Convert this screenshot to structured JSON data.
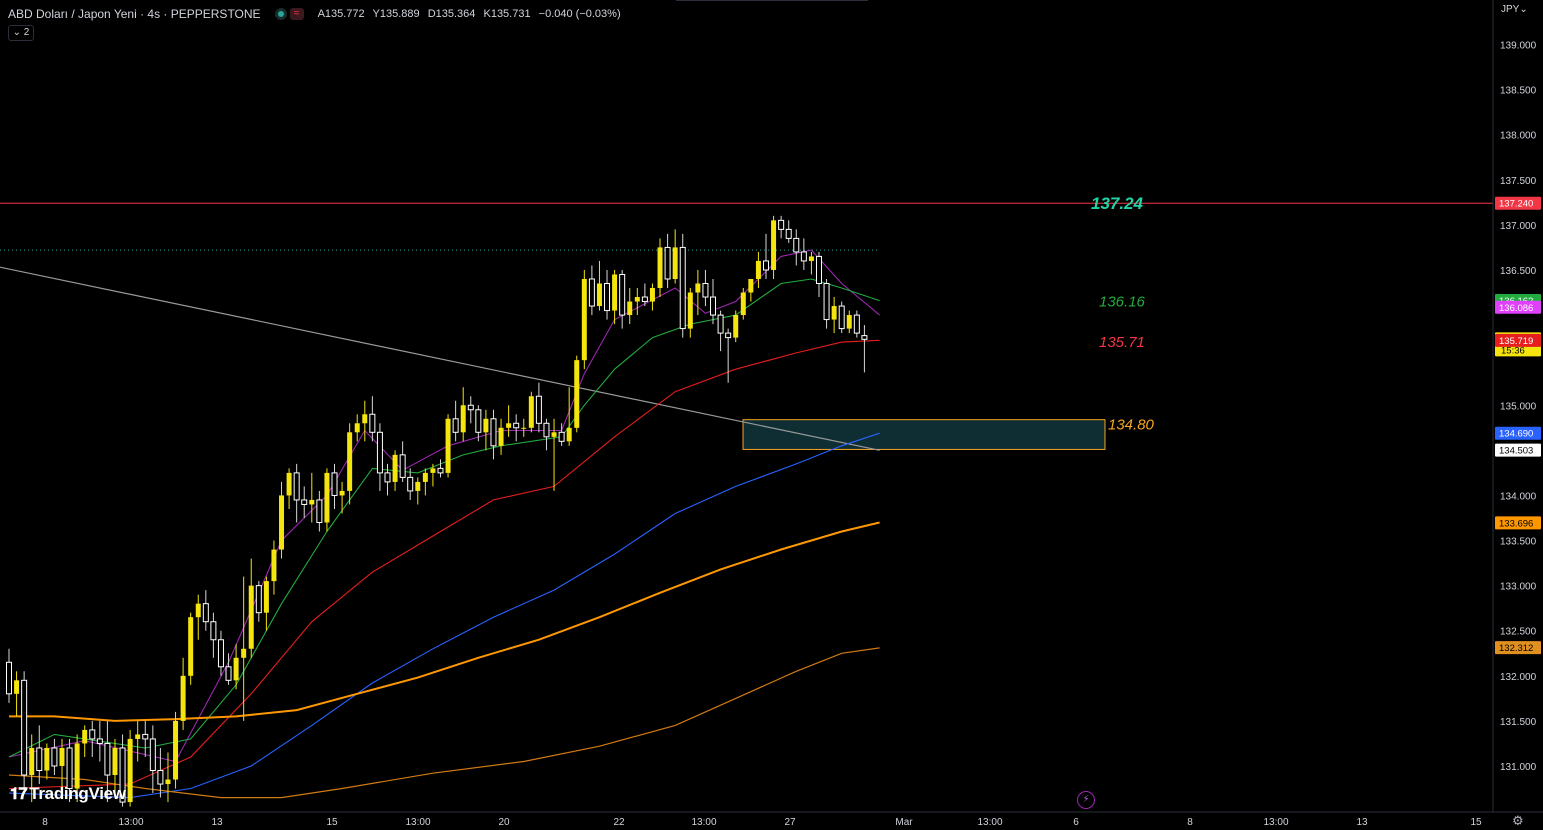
{
  "header": {
    "title": "ABD Doları / Japon Yeni · 4s · PEPPERSTONE",
    "wave_icon": "wave-icon",
    "open": "A135.772",
    "high": "Y135.889",
    "low": "D135.364",
    "close": "K135.731",
    "change": "−0.040 (−0.03%)",
    "collapse": "⌄ 2"
  },
  "currency": "JPY⌄",
  "brand": "TradingView",
  "colors": {
    "background": "#000000",
    "bull_candle": "#f5e50f",
    "bear_candle": "#ffffff",
    "resistance": "#f23645",
    "ema_8": "#9c27b0",
    "ema_21": "#22ab3e",
    "ema_50": "#e61e1e",
    "ema_100": "#2962ff",
    "ema_200": "#ff9800",
    "ema_400": "#d07a12",
    "trendline": "#9a9a9a",
    "zone_fill": "#0f2e33",
    "zone_border": "#f5a623"
  },
  "chart_data": {
    "type": "candlestick",
    "symbol": "USDJPY",
    "timeframe": "4s",
    "ylim": [
      130.55,
      139.3
    ],
    "x_tick_labels": [
      "8",
      "13:00",
      "13",
      "15",
      "13:00",
      "20",
      "22",
      "13:00",
      "27",
      "Mar",
      "13:00",
      "6",
      "8",
      "13:00",
      "13",
      "15"
    ],
    "y_tick_labels": [
      "139.000",
      "138.500",
      "138.000",
      "137.500",
      "137.000",
      "136.500",
      "135.000",
      "134.000",
      "133.500",
      "133.000",
      "132.500",
      "132.000",
      "131.500",
      "131.000"
    ],
    "price_tags": [
      {
        "value": 137.24,
        "label": "137.240",
        "color": "#f23645",
        "text_color": "#ffffff"
      },
      {
        "value": 136.162,
        "label": "136.162",
        "color": "#22ab3e",
        "text_color": "#ffffff"
      },
      {
        "value": 136.086,
        "label": "136.086",
        "color": "#e040fb",
        "text_color": "#ffffff"
      },
      {
        "value": 135.731,
        "label": "135.731",
        "sub": "15:36",
        "color": "#f5e50f",
        "text_color": "#000000"
      },
      {
        "value": 135.719,
        "label": "135.719",
        "color": "#e61e1e",
        "text_color": "#ffffff"
      },
      {
        "value": 134.69,
        "label": "134.690",
        "color": "#2962ff",
        "text_color": "#ffffff"
      },
      {
        "value": 134.503,
        "label": "134.503",
        "color": "#ffffff",
        "text_color": "#000000"
      },
      {
        "value": 133.696,
        "label": "133.696",
        "color": "#ff9800",
        "text_color": "#000000"
      },
      {
        "value": 132.312,
        "label": "132.312",
        "color": "#e0901f",
        "text_color": "#000000"
      }
    ],
    "annotations": [
      {
        "text": "137.24",
        "value": 137.24,
        "color": "#22d3a6"
      },
      {
        "text": "136.16",
        "value": 136.16,
        "color": "#22ab3e"
      },
      {
        "text": "135.71",
        "value": 135.71,
        "color": "#f23645"
      },
      {
        "text": "134.80",
        "value": 134.8,
        "color": "#f5a623"
      }
    ],
    "levels": {
      "resistance": 137.24,
      "dotted_level": 136.72,
      "zone_top": 134.84,
      "zone_bottom": 134.51
    },
    "candles": [
      [
        132.15,
        132.3,
        131.7,
        131.8
      ],
      [
        131.8,
        132.05,
        131.55,
        131.95
      ],
      [
        131.95,
        132.05,
        130.75,
        130.9
      ],
      [
        130.9,
        131.35,
        130.6,
        131.2
      ],
      [
        131.2,
        131.45,
        130.8,
        130.95
      ],
      [
        130.95,
        131.25,
        130.85,
        131.2
      ],
      [
        131.2,
        131.3,
        130.9,
        131.0
      ],
      [
        131.0,
        131.3,
        130.65,
        131.2
      ],
      [
        131.2,
        131.3,
        130.6,
        130.75
      ],
      [
        130.75,
        131.35,
        130.6,
        131.25
      ],
      [
        131.25,
        131.45,
        131.1,
        131.4
      ],
      [
        131.4,
        131.5,
        131.1,
        131.3
      ],
      [
        131.3,
        131.5,
        131.05,
        131.25
      ],
      [
        131.25,
        131.5,
        130.6,
        130.9
      ],
      [
        130.9,
        131.3,
        130.7,
        131.2
      ],
      [
        131.2,
        131.35,
        130.55,
        130.6
      ],
      [
        130.6,
        131.4,
        130.55,
        131.3
      ],
      [
        131.3,
        131.5,
        131.05,
        131.35
      ],
      [
        131.35,
        131.5,
        131.1,
        131.3
      ],
      [
        131.3,
        131.45,
        130.7,
        130.95
      ],
      [
        130.95,
        131.2,
        130.65,
        130.8
      ],
      [
        130.8,
        131.15,
        130.6,
        130.85
      ],
      [
        130.85,
        131.6,
        130.75,
        131.5
      ],
      [
        131.5,
        132.2,
        131.4,
        132.0
      ],
      [
        132.0,
        132.7,
        131.9,
        132.65
      ],
      [
        132.65,
        132.9,
        132.4,
        132.8
      ],
      [
        132.8,
        132.95,
        132.5,
        132.6
      ],
      [
        132.6,
        132.7,
        132.2,
        132.4
      ],
      [
        132.4,
        132.5,
        132.0,
        132.1
      ],
      [
        132.1,
        132.25,
        131.9,
        131.95
      ],
      [
        131.95,
        132.35,
        131.85,
        132.2
      ],
      [
        132.2,
        133.1,
        131.5,
        132.3
      ],
      [
        132.3,
        133.3,
        132.2,
        133.0
      ],
      [
        133.0,
        133.05,
        132.6,
        132.7
      ],
      [
        132.7,
        133.1,
        132.5,
        133.05
      ],
      [
        133.05,
        133.5,
        132.9,
        133.4
      ],
      [
        133.4,
        134.15,
        133.3,
        134.0
      ],
      [
        134.0,
        134.3,
        133.85,
        134.25
      ],
      [
        134.25,
        134.35,
        133.7,
        133.95
      ],
      [
        133.95,
        134.1,
        133.75,
        133.9
      ],
      [
        133.9,
        134.25,
        133.7,
        133.95
      ],
      [
        133.95,
        134.05,
        133.6,
        133.7
      ],
      [
        133.7,
        134.3,
        133.6,
        134.25
      ],
      [
        134.25,
        134.35,
        133.85,
        134.0
      ],
      [
        134.0,
        134.15,
        133.8,
        134.05
      ],
      [
        134.05,
        134.8,
        133.9,
        134.7
      ],
      [
        134.7,
        134.9,
        134.6,
        134.8
      ],
      [
        134.8,
        135.05,
        134.6,
        134.9
      ],
      [
        134.9,
        135.1,
        134.6,
        134.7
      ],
      [
        134.7,
        134.8,
        134.05,
        134.25
      ],
      [
        134.25,
        134.35,
        134.0,
        134.15
      ],
      [
        134.15,
        134.5,
        134.05,
        134.45
      ],
      [
        134.45,
        134.6,
        134.15,
        134.2
      ],
      [
        134.2,
        134.3,
        133.95,
        134.05
      ],
      [
        134.05,
        134.2,
        133.9,
        134.15
      ],
      [
        134.15,
        134.3,
        134.0,
        134.25
      ],
      [
        134.25,
        134.35,
        134.1,
        134.3
      ],
      [
        134.3,
        134.4,
        134.2,
        134.25
      ],
      [
        134.25,
        134.9,
        134.2,
        134.85
      ],
      [
        134.85,
        135.05,
        134.6,
        134.7
      ],
      [
        134.7,
        135.2,
        134.6,
        135.0
      ],
      [
        135.0,
        135.1,
        134.8,
        134.95
      ],
      [
        134.95,
        135.0,
        134.6,
        134.7
      ],
      [
        134.7,
        134.95,
        134.5,
        134.85
      ],
      [
        134.85,
        134.95,
        134.4,
        134.55
      ],
      [
        134.55,
        134.85,
        134.45,
        134.75
      ],
      [
        134.75,
        135.0,
        134.65,
        134.8
      ],
      [
        134.8,
        134.9,
        134.6,
        134.75
      ],
      [
        134.75,
        134.85,
        134.65,
        134.75
      ],
      [
        134.75,
        135.15,
        134.7,
        135.1
      ],
      [
        135.1,
        135.25,
        134.7,
        134.8
      ],
      [
        134.8,
        134.85,
        134.5,
        134.65
      ],
      [
        134.65,
        134.85,
        134.05,
        134.7
      ],
      [
        134.7,
        134.8,
        134.55,
        134.6
      ],
      [
        134.6,
        135.2,
        134.55,
        134.75
      ],
      [
        134.75,
        135.55,
        134.7,
        135.5
      ],
      [
        135.5,
        136.5,
        135.4,
        136.4
      ],
      [
        136.4,
        136.55,
        136.0,
        136.1
      ],
      [
        136.1,
        136.6,
        136.05,
        136.35
      ],
      [
        136.35,
        136.5,
        135.95,
        136.05
      ],
      [
        136.05,
        136.5,
        135.9,
        136.45
      ],
      [
        136.45,
        136.5,
        135.85,
        136.0
      ],
      [
        136.0,
        136.3,
        135.9,
        136.15
      ],
      [
        136.15,
        136.3,
        136.0,
        136.2
      ],
      [
        136.2,
        136.35,
        136.1,
        136.15
      ],
      [
        136.15,
        136.35,
        136.05,
        136.3
      ],
      [
        136.3,
        136.85,
        136.2,
        136.75
      ],
      [
        136.75,
        136.9,
        136.3,
        136.4
      ],
      [
        136.4,
        136.95,
        136.35,
        136.75
      ],
      [
        136.75,
        136.9,
        135.75,
        135.85
      ],
      [
        135.85,
        136.3,
        135.75,
        136.25
      ],
      [
        136.25,
        136.5,
        136.0,
        136.35
      ],
      [
        136.35,
        136.5,
        136.1,
        136.2
      ],
      [
        136.2,
        136.4,
        135.9,
        136.0
      ],
      [
        136.0,
        136.05,
        135.6,
        135.8
      ],
      [
        135.8,
        135.85,
        135.25,
        135.75
      ],
      [
        135.75,
        136.05,
        135.7,
        136.0
      ],
      [
        136.0,
        136.3,
        135.95,
        136.25
      ],
      [
        136.25,
        136.4,
        136.15,
        136.4
      ],
      [
        136.4,
        136.7,
        136.3,
        136.6
      ],
      [
        136.6,
        136.9,
        136.4,
        136.5
      ],
      [
        136.5,
        137.1,
        136.4,
        137.05
      ],
      [
        137.05,
        137.1,
        136.85,
        136.95
      ],
      [
        136.95,
        137.05,
        136.8,
        136.85
      ],
      [
        136.85,
        136.95,
        136.55,
        136.7
      ],
      [
        136.7,
        136.85,
        136.5,
        136.6
      ],
      [
        136.6,
        136.7,
        136.45,
        136.65
      ],
      [
        136.65,
        136.7,
        136.2,
        136.35
      ],
      [
        136.35,
        136.4,
        135.85,
        135.95
      ],
      [
        135.95,
        136.2,
        135.8,
        136.1
      ],
      [
        136.1,
        136.15,
        135.8,
        135.85
      ],
      [
        135.85,
        136.05,
        135.8,
        136.0
      ],
      [
        136.0,
        136.05,
        135.75,
        135.8
      ],
      [
        135.772,
        135.889,
        135.364,
        135.731
      ]
    ],
    "series": [
      {
        "name": "EMA 8",
        "color": "#9c27b0",
        "points": [
          [
            0,
            131.1
          ],
          [
            10,
            131.28
          ],
          [
            22,
            131.05
          ],
          [
            29,
            132.15
          ],
          [
            36,
            133.5
          ],
          [
            42,
            134.0
          ],
          [
            47,
            134.72
          ],
          [
            52,
            134.28
          ],
          [
            58,
            134.55
          ],
          [
            65,
            134.72
          ],
          [
            73,
            134.72
          ],
          [
            76,
            135.35
          ],
          [
            80,
            135.95
          ],
          [
            88,
            136.3
          ],
          [
            92,
            136.02
          ],
          [
            96,
            136.15
          ],
          [
            102,
            136.65
          ],
          [
            106,
            136.72
          ],
          [
            110,
            136.35
          ],
          [
            115,
            136.0
          ]
        ]
      },
      {
        "name": "EMA 21",
        "color": "#22ab3e",
        "points": [
          [
            0,
            131.1
          ],
          [
            6,
            131.35
          ],
          [
            18,
            131.2
          ],
          [
            24,
            131.3
          ],
          [
            30,
            131.9
          ],
          [
            36,
            132.8
          ],
          [
            42,
            133.6
          ],
          [
            48,
            134.3
          ],
          [
            54,
            134.25
          ],
          [
            60,
            134.45
          ],
          [
            65,
            134.55
          ],
          [
            73,
            134.65
          ],
          [
            76,
            135.0
          ],
          [
            80,
            135.4
          ],
          [
            85,
            135.75
          ],
          [
            90,
            135.9
          ],
          [
            96,
            136.0
          ],
          [
            102,
            136.35
          ],
          [
            106,
            136.4
          ],
          [
            110,
            136.3
          ],
          [
            115,
            136.16
          ]
        ]
      },
      {
        "name": "EMA 50",
        "color": "#e61e1e",
        "points": [
          [
            0,
            130.75
          ],
          [
            16,
            130.8
          ],
          [
            24,
            131.1
          ],
          [
            32,
            131.8
          ],
          [
            40,
            132.6
          ],
          [
            48,
            133.15
          ],
          [
            56,
            133.55
          ],
          [
            64,
            133.95
          ],
          [
            72,
            134.1
          ],
          [
            80,
            134.65
          ],
          [
            88,
            135.15
          ],
          [
            96,
            135.4
          ],
          [
            104,
            135.58
          ],
          [
            110,
            135.7
          ],
          [
            115,
            135.72
          ]
        ]
      },
      {
        "name": "EMA 100",
        "color": "#2962ff",
        "points": [
          [
            0,
            130.7
          ],
          [
            16,
            130.65
          ],
          [
            24,
            130.75
          ],
          [
            32,
            131.0
          ],
          [
            40,
            131.45
          ],
          [
            48,
            131.92
          ],
          [
            56,
            132.3
          ],
          [
            64,
            132.65
          ],
          [
            72,
            132.95
          ],
          [
            80,
            133.35
          ],
          [
            88,
            133.8
          ],
          [
            96,
            134.1
          ],
          [
            104,
            134.35
          ],
          [
            110,
            134.55
          ],
          [
            115,
            134.69
          ]
        ]
      },
      {
        "name": "EMA 200",
        "color": "#ff9800",
        "points": [
          [
            0,
            131.55
          ],
          [
            6,
            131.55
          ],
          [
            14,
            131.5
          ],
          [
            22,
            131.52
          ],
          [
            30,
            131.55
          ],
          [
            38,
            131.62
          ],
          [
            46,
            131.8
          ],
          [
            54,
            131.98
          ],
          [
            62,
            132.2
          ],
          [
            70,
            132.4
          ],
          [
            78,
            132.65
          ],
          [
            86,
            132.92
          ],
          [
            94,
            133.18
          ],
          [
            102,
            133.4
          ],
          [
            110,
            133.6
          ],
          [
            115,
            133.7
          ]
        ]
      },
      {
        "name": "EMA 400",
        "color": "#d07a12",
        "points": [
          [
            0,
            130.9
          ],
          [
            10,
            130.85
          ],
          [
            18,
            130.75
          ],
          [
            28,
            130.65
          ],
          [
            36,
            130.65
          ],
          [
            44,
            130.75
          ],
          [
            56,
            130.92
          ],
          [
            68,
            131.05
          ],
          [
            78,
            131.22
          ],
          [
            88,
            131.45
          ],
          [
            96,
            131.75
          ],
          [
            104,
            132.05
          ],
          [
            110,
            132.25
          ],
          [
            115,
            132.31
          ]
        ]
      }
    ],
    "trendline": {
      "start": [
        -8,
        136.65
      ],
      "end": [
        115,
        134.5
      ]
    }
  }
}
